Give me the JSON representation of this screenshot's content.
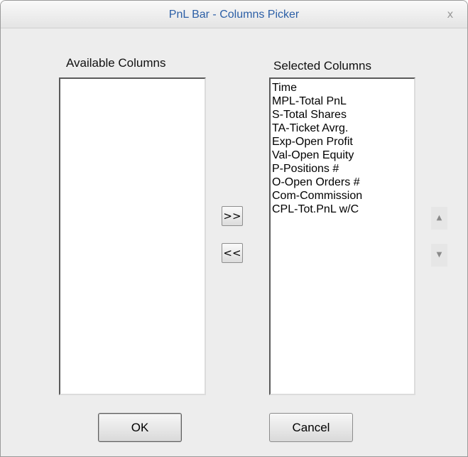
{
  "window": {
    "title": "PnL Bar - Columns Picker",
    "close_glyph": "x"
  },
  "available": {
    "label": "Available Columns",
    "items": []
  },
  "selected": {
    "label": "Selected Columns",
    "items": [
      "Time",
      "MPL-Total PnL",
      "S-Total Shares",
      "TA-Ticket Avrg.",
      "Exp-Open Profit",
      "Val-Open Equity",
      "P-Positions #",
      "O-Open Orders #",
      "Com-Commission",
      "CPL-Tot.PnL w/C"
    ]
  },
  "transfer": {
    "add_label": ">>",
    "remove_label": "<<"
  },
  "order": {
    "up_icon": "triangle-up-icon",
    "down_icon": "triangle-down-icon",
    "up_glyph": "▲",
    "down_glyph": "▼"
  },
  "buttons": {
    "ok": "OK",
    "cancel": "Cancel"
  },
  "colors": {
    "title_text": "#2c5fa6",
    "dialog_bg": "#ededed",
    "list_bg": "#ffffff"
  }
}
